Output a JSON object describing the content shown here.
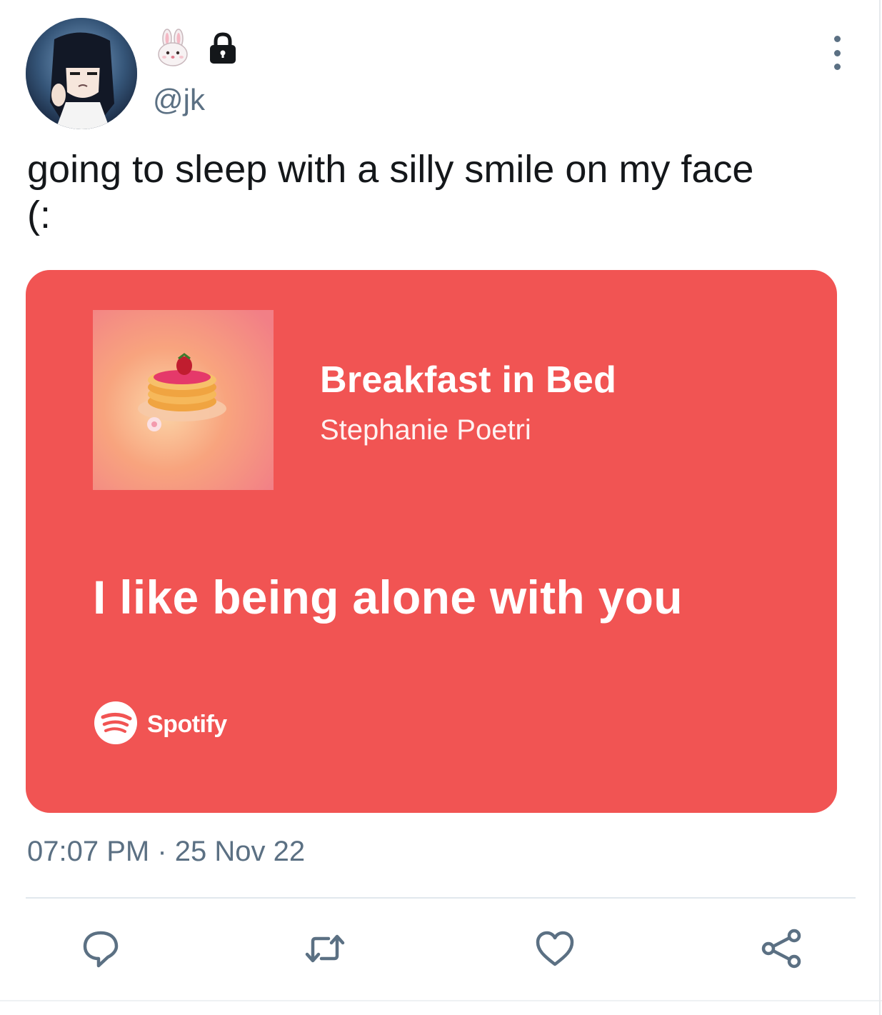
{
  "author": {
    "handle": "@jk",
    "name_icons": [
      "rabbit-face-icon",
      "lock-icon"
    ]
  },
  "tweet": {
    "text": "going to sleep with a silly smile on my face\n(:",
    "timestamp": "07:07 PM · 25 Nov 22"
  },
  "card": {
    "background_color": "#f15453",
    "track_title": "Breakfast in Bed",
    "artist": "Stephanie Poetri",
    "lyric": "I like being alone with you",
    "brand": "Spotify"
  },
  "actions": [
    {
      "icon": "reply-icon"
    },
    {
      "icon": "retweet-icon"
    },
    {
      "icon": "like-icon"
    },
    {
      "icon": "share-icon"
    }
  ],
  "colors": {
    "secondary_text": "#5b7083",
    "primary_text": "#14171a"
  }
}
